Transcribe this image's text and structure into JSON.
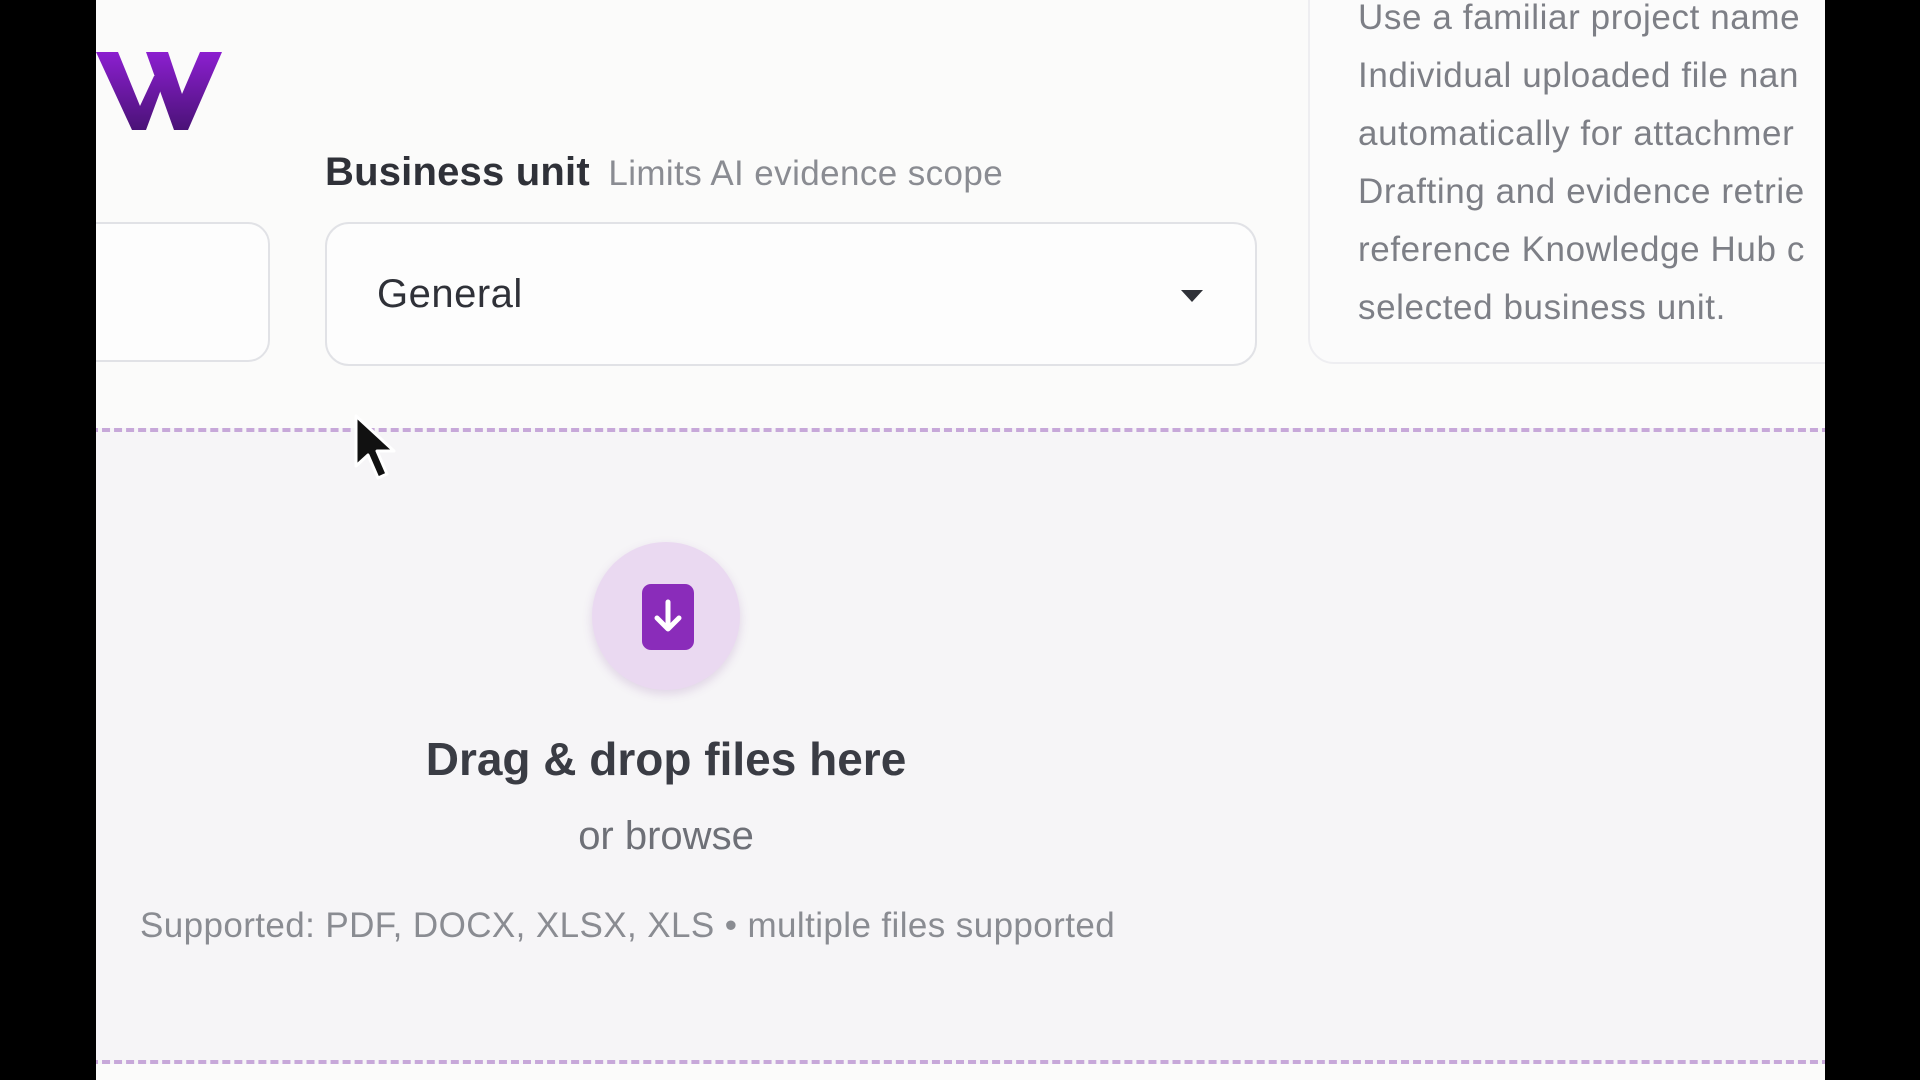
{
  "brand": {
    "logo_icon": "v-logo-icon",
    "logo_color_start": "#8c1fd0",
    "logo_color_end": "#4a1277"
  },
  "business_unit": {
    "label": "Business unit",
    "hint": "Limits AI evidence scope",
    "selected_value": "General",
    "caret_icon": "caret-down-icon"
  },
  "help_card": {
    "lines": [
      "Use a familiar project name",
      "Individual uploaded file nan",
      "automatically for attachmer",
      "Drafting and evidence retrie",
      "reference Knowledge Hub c",
      "selected business unit."
    ]
  },
  "dropzone": {
    "icon": "download-file-icon",
    "title": "Drag & drop files here",
    "browse_text": "or browse",
    "supported_text": "Supported: PDF, DOCX, XLSX, XLS • multiple files supported",
    "accent_color": "#8a2cba",
    "border_color": "#c7a8d9"
  },
  "pointer": {
    "icon": "mouse-pointer-icon"
  }
}
